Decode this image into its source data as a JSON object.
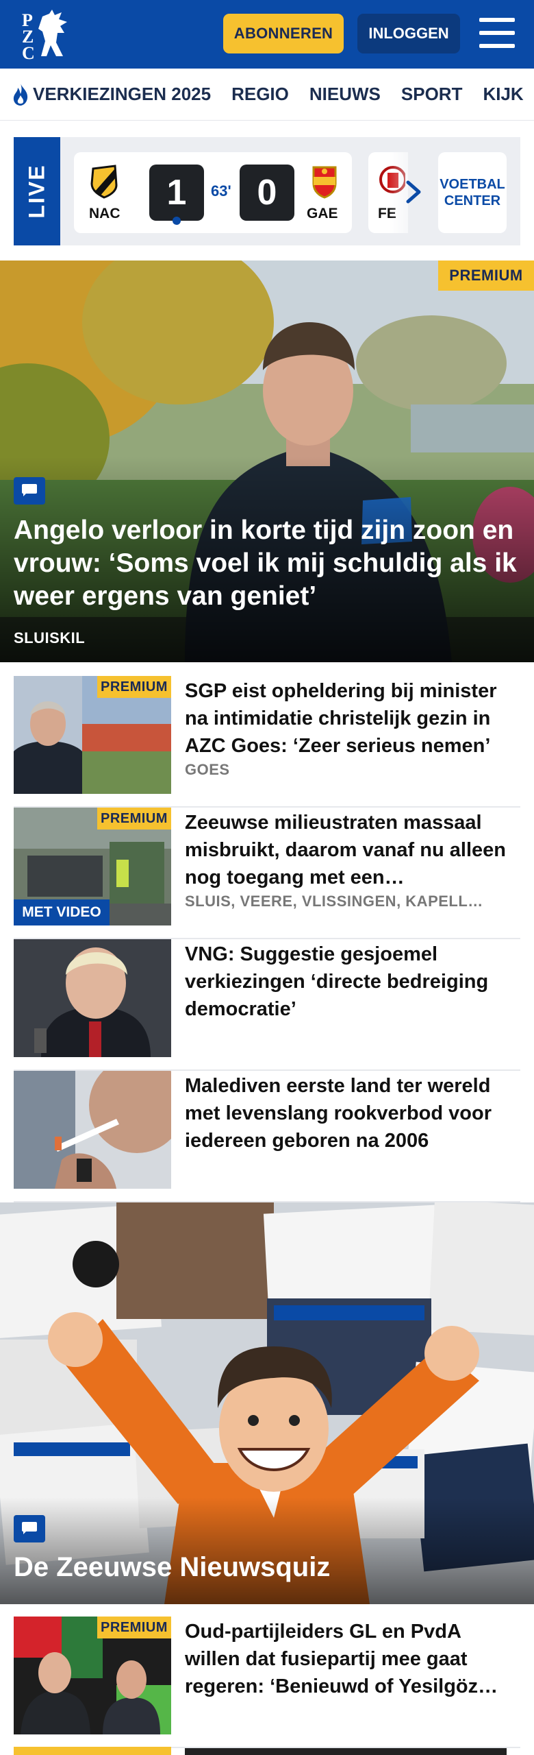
{
  "header": {
    "logo_letters": [
      "P",
      "Z",
      "C"
    ],
    "subscribe_label": "ABONNEREN",
    "login_label": "INLOGGEN"
  },
  "nav": {
    "items": [
      "VERKIEZINGEN 2025",
      "REGIO",
      "NIEUWS",
      "SPORT",
      "KIJK"
    ]
  },
  "live": {
    "label": "LIVE",
    "match": {
      "home": "NAC",
      "away": "GAE",
      "home_score": "1",
      "away_score": "0",
      "minute": "63'"
    },
    "next_team": "FE",
    "voetbal_center_label": "VOETBAL CENTER"
  },
  "hero": {
    "badge": "PREMIUM",
    "title": "Angelo verloor in korte tijd zijn zoon en vrouw: ‘Soms voel ik mij schuldig als ik weer ergens van geniet’",
    "location": "SLUISKIL"
  },
  "articles": [
    {
      "badge": "PREMIUM",
      "title": "SGP eist opheldering bij minister na intimidatie christelijk gezin in AZC Goes: ‘Zeer serieus nemen’",
      "location": "GOES"
    },
    {
      "badge": "PREMIUM",
      "video": "MET VIDEO",
      "title": "Zeeuwse milieustraten massaal misbruikt, daarom vanaf nu alleen nog toegang met een…",
      "location": "SLUIS, VEERE, VLISSINGEN, KAPELL…"
    },
    {
      "title": "VNG: Suggestie gesjoemel verkiezingen ‘directe bedreiging democratie’"
    },
    {
      "title": "Malediven eerste land ter wereld met levenslang rookverbod voor iedereen geboren na 2006"
    },
    {
      "badge": "PREMIUM",
      "title": "Oud-partijleiders GL en PvdA willen dat fusiepartij mee gaat regeren: ‘Benieuwd of Yesilgöz…"
    }
  ],
  "quiz": {
    "title": "De Zeeuwse Nieuwsquiz"
  },
  "colors": {
    "brand_blue": "#0a4aa6",
    "premium_yellow": "#f6c12f",
    "dark_navy": "#0c3a7e"
  }
}
